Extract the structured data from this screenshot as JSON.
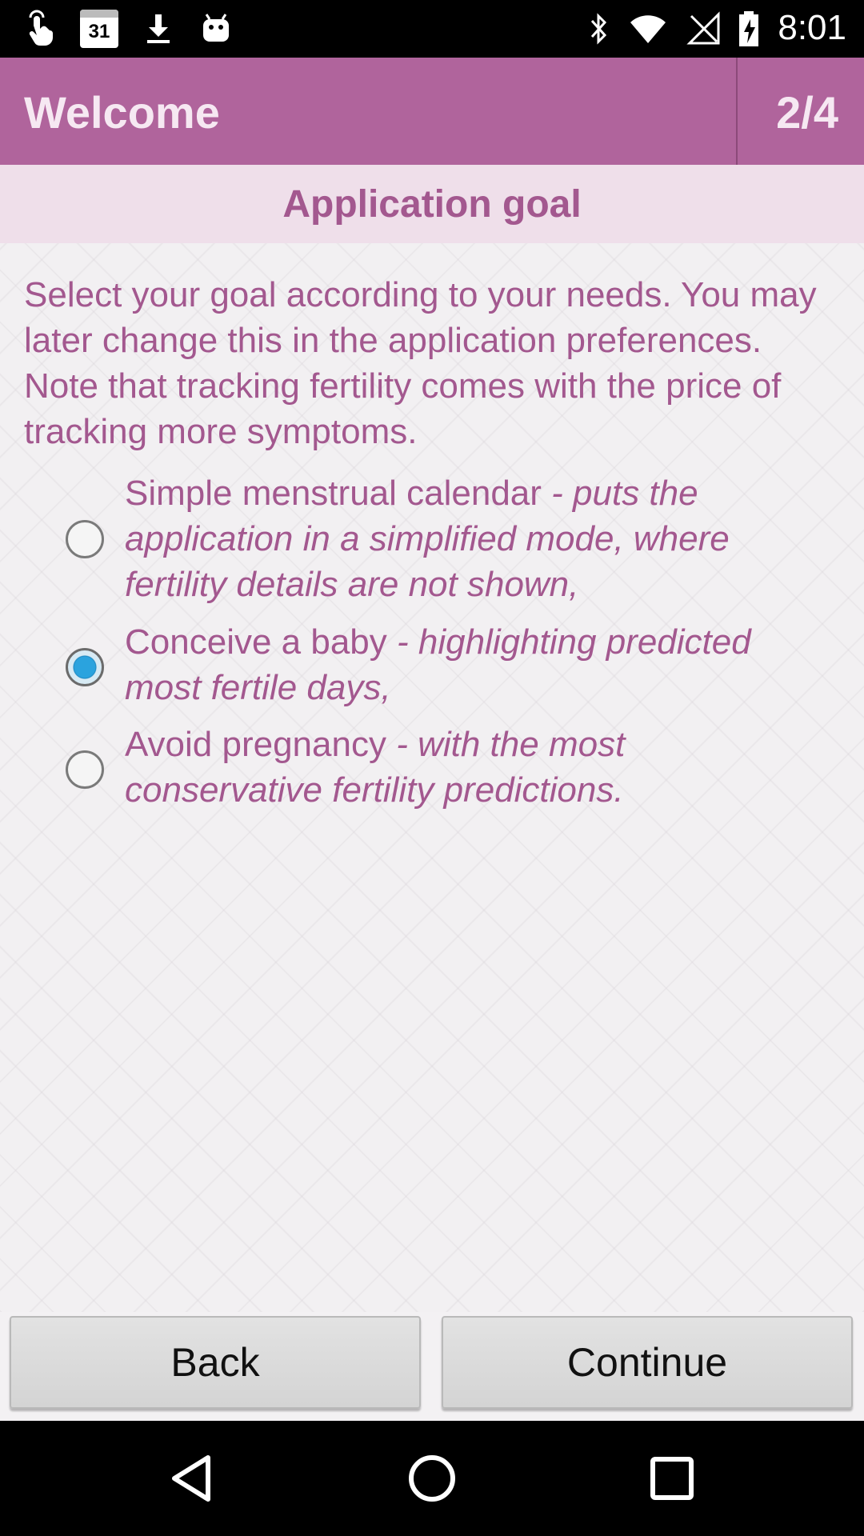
{
  "status_bar": {
    "time": "8:01",
    "left_icons": [
      "touch-icon",
      "calendar-icon",
      "download-icon",
      "android-icon"
    ],
    "calendar_day": "31",
    "right_icons": [
      "bluetooth-icon",
      "wifi-icon",
      "no-signal-icon",
      "battery-charging-icon"
    ]
  },
  "header": {
    "title": "Welcome",
    "step": "2/4"
  },
  "section": {
    "title": "Application goal"
  },
  "intro_text": "Select your goal according to your needs. You may later change this in the application preferences. Note that tracking fertility comes with the price of tracking more symptoms.",
  "options": [
    {
      "label": "Simple menstrual calendar",
      "description": " - puts the application in a simplified mode, where fertility details are not shown,",
      "selected": false
    },
    {
      "label": "Conceive a baby",
      "description": " - highlighting predicted most fertile days,",
      "selected": true
    },
    {
      "label": "Avoid pregnancy",
      "description": " - with the most conservative fertility predictions.",
      "selected": false
    }
  ],
  "buttons": {
    "back": "Back",
    "continue": "Continue"
  },
  "nav_bar": {
    "icons": [
      "back-triangle-icon",
      "home-circle-icon",
      "recents-square-icon"
    ]
  },
  "colors": {
    "header": "#b0649c",
    "subheader": "#efdfea",
    "text_accent": "#a3588f",
    "radio_selected": "#2aa3de"
  }
}
